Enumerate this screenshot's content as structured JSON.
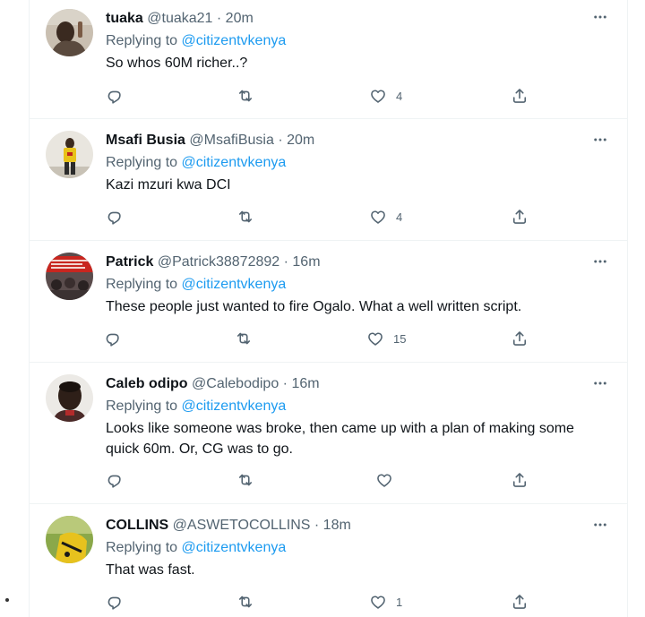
{
  "replying_label": "Replying to",
  "colors": {
    "accent": "#1d9bf0",
    "muted": "#536471",
    "text": "#0f1419",
    "divider": "#eff3f4"
  },
  "icons": {
    "more": "more-horizontal-icon",
    "reply": "reply-bubble-icon",
    "retweet": "retweet-icon",
    "like": "heart-icon",
    "share": "share-upload-icon"
  },
  "tweets": [
    {
      "name": "tuaka",
      "handle": "@tuaka21",
      "dot": "·",
      "time": "20m",
      "mention": "@citizentvkenya",
      "text": "So whos 60M richer..?",
      "likes": "4"
    },
    {
      "name": "Msafi Busia",
      "handle": "@MsafiBusia",
      "dot": "·",
      "time": "20m",
      "mention": "@citizentvkenya",
      "text": "Kazi mzuri kwa DCI",
      "likes": "4"
    },
    {
      "name": "Patrick",
      "handle": "@Patrick38872892",
      "dot": "·",
      "time": "16m",
      "mention": "@citizentvkenya",
      "text": "These people just wanted to fire Ogalo. What a well written script.",
      "likes": "15"
    },
    {
      "name": "Caleb odipo",
      "handle": "@Calebodipo",
      "dot": "·",
      "time": "16m",
      "mention": "@citizentvkenya",
      "text": "Looks like someone was broke, then came up with a plan of making some quick 60m. Or, CG was to go.",
      "likes": ""
    },
    {
      "name": "COLLINS",
      "handle": "@ASWETOCOLLINS",
      "dot": "·",
      "time": "18m",
      "mention": "@citizentvkenya",
      "text": "That was fast.",
      "likes": "1"
    }
  ]
}
